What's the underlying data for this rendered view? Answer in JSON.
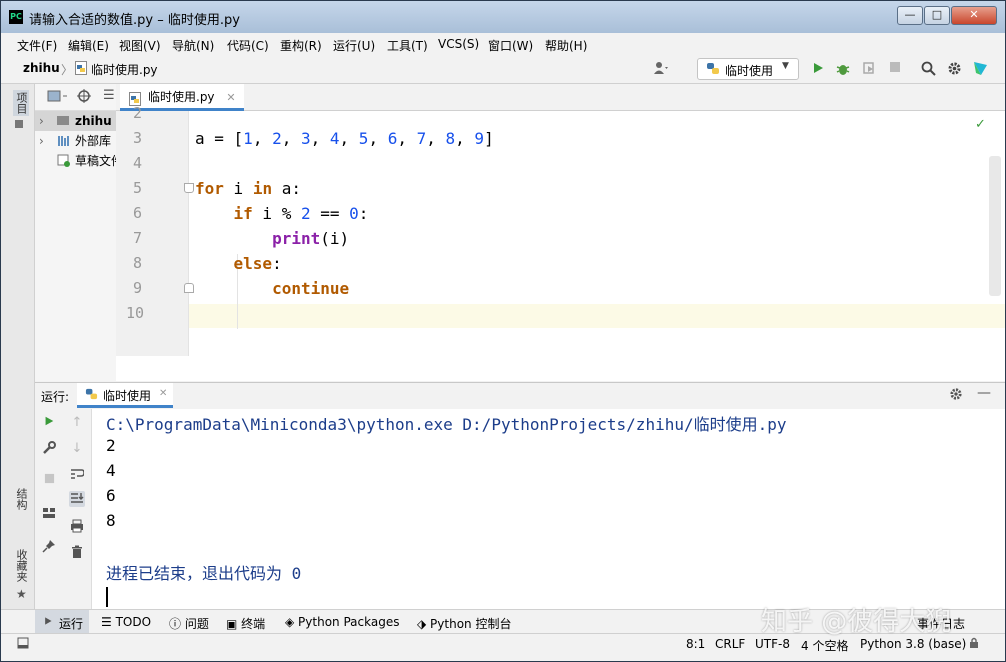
{
  "window": {
    "title": "请输入合适的数值.py – 临时使用.py",
    "app_icon_text": "PC",
    "minimize": "—",
    "maximize": "□",
    "close": "✕"
  },
  "menu": [
    "文件(F)",
    "编辑(E)",
    "视图(V)",
    "导航(N)",
    "代码(C)",
    "重构(R)",
    "运行(U)",
    "工具(T)",
    "VCS(S)",
    "窗口(W)",
    "帮助(H)"
  ],
  "breadcrumb": {
    "project": "zhihu",
    "separator": "〉",
    "file": "临时使用.py"
  },
  "toolbar": {
    "run_config": "临时使用"
  },
  "left_strip": {
    "project_tab": "项目",
    "structure_tab": "结构",
    "favorites_tab": "收藏夹"
  },
  "project_tree": [
    {
      "label": "zhihu"
    },
    {
      "label": "外部库"
    },
    {
      "label": "草稿文件和控制台"
    }
  ],
  "editor": {
    "tab_label": "临时使用.py",
    "line_numbers": [
      "2",
      "3",
      "4",
      "5",
      "6",
      "7",
      "8",
      "9",
      "10"
    ],
    "code": {
      "l3_a": "a = [",
      "l3_nums": [
        "1",
        "2",
        "3",
        "4",
        "5",
        "6",
        "7",
        "8",
        "9"
      ],
      "l5_for": "for",
      "l5_i": " i ",
      "l5_in": "in",
      "l5_rest": " a:",
      "l6_if": "if",
      "l6_mid": " i % ",
      "l6_two": "2",
      "l6_eq": " == ",
      "l6_zero": "0",
      "l6_colon": ":",
      "l7_print": "print",
      "l7_args": "(i)",
      "l8_else": "else",
      "l8_colon": ":",
      "l9_continue": "continue"
    }
  },
  "run_panel": {
    "label": "运行:",
    "tab_label": "临时使用",
    "output": [
      "C:\\ProgramData\\Miniconda3\\python.exe D:/PythonProjects/zhihu/临时使用.py",
      "2",
      "4",
      "6",
      "8",
      "",
      "进程已结束，退出代码为 0"
    ]
  },
  "bottom_tools": [
    "运行",
    "TODO",
    "问题",
    "终端",
    "Python Packages",
    "Python 控制台",
    "事件日志"
  ],
  "status": {
    "position": "8:1",
    "line_sep": "CRLF",
    "encoding": "UTF-8",
    "indent": "4 个空格",
    "interpreter": "Python 3.8 (base)"
  },
  "watermark": "知乎 @彼得大猊",
  "colors": {
    "keyword": "#b15a00",
    "number": "#1750eb",
    "builtin": "#8b21a8",
    "run_green": "#3a9a3a",
    "current_line": "#fcfae6"
  }
}
